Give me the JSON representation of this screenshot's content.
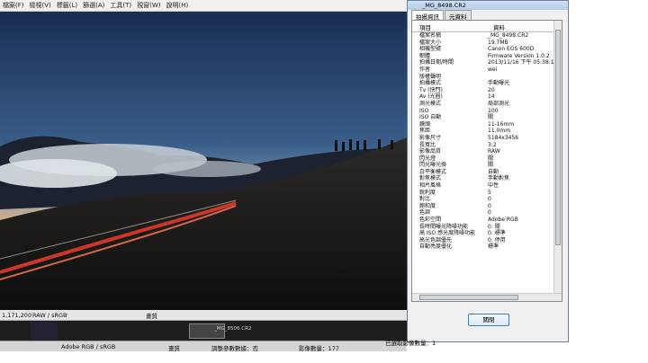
{
  "main_window": {
    "menu": [
      "檔案(F)",
      "檢視(V)",
      "標籤(L)",
      "篩選(A)",
      "工具(T)",
      "視窗(W)",
      "說明(H)"
    ],
    "status": {
      "resolution_fragment": "1,171,200",
      "color_mode": "RAW / sRGB",
      "quality": "畫質",
      "filmstrip_label": "_MG_8506.CR2",
      "color_profile": "Adobe RGB / sRGB",
      "quality_2": "畫質",
      "adjust_count": "調整參數數據：否",
      "image_count": "影像數量：177",
      "extra_text": "已選取影像數量：1"
    }
  },
  "properties_window": {
    "title": "_MG_8498.CR2",
    "tabs": [
      "拍攝資訊",
      "元資料"
    ],
    "table": {
      "col_item": "項目",
      "col_value": "資料",
      "rows": [
        {
          "k": "檔案名稱",
          "v": "_MG_8498.CR2"
        },
        {
          "k": "檔案大小",
          "v": "19.7MB"
        },
        {
          "k": "相機型號",
          "v": "Canon EOS 600D"
        },
        {
          "k": "韌體",
          "v": "Firmware Version 1.0.2"
        },
        {
          "k": "拍攝日期/時間",
          "v": "2013/11/16 下午 05:38:10"
        },
        {
          "k": "作者",
          "v": "wei"
        },
        {
          "k": "版權聲明",
          "v": ""
        },
        {
          "k": "拍攝模式",
          "v": "手動曝光"
        },
        {
          "k": "Tv (快門)",
          "v": "20"
        },
        {
          "k": "Av (光圈)",
          "v": "14"
        },
        {
          "k": "測光模式",
          "v": "局部測光"
        },
        {
          "k": "ISO",
          "v": "100"
        },
        {
          "k": "ISO 自動",
          "v": "關"
        },
        {
          "k": "鏡頭",
          "v": "11-16mm"
        },
        {
          "k": "焦距",
          "v": "11.0mm"
        },
        {
          "k": "影像尺寸",
          "v": "5184x3456"
        },
        {
          "k": "長寬比",
          "v": "3:2"
        },
        {
          "k": "影像品質",
          "v": "RAW"
        },
        {
          "k": "閃光燈",
          "v": "關"
        },
        {
          "k": "閃光曝光換",
          "v": "關"
        },
        {
          "k": "白平衡模式",
          "v": "自動"
        },
        {
          "k": "對焦模式",
          "v": "手動對焦"
        },
        {
          "k": "相片風格",
          "v": "中性"
        },
        {
          "k": "銳利度",
          "v": "5"
        },
        {
          "k": "對比",
          "v": "0"
        },
        {
          "k": "飽和度",
          "v": "0"
        },
        {
          "k": "色調",
          "v": "0"
        },
        {
          "k": "色彩空間",
          "v": "Adobe RGB"
        },
        {
          "k": "長時間曝光降噪功能",
          "v": "0: 關"
        },
        {
          "k": "高 ISO 感光度降噪功能",
          "v": "0: 標準"
        },
        {
          "k": "高光色調優先",
          "v": "0: 停用"
        },
        {
          "k": "自動亮度優化",
          "v": "標準"
        }
      ]
    },
    "close_label": "關閉"
  },
  "colors": {
    "titlebar": "#b6cce6",
    "button_border": "#3c7fb1"
  }
}
